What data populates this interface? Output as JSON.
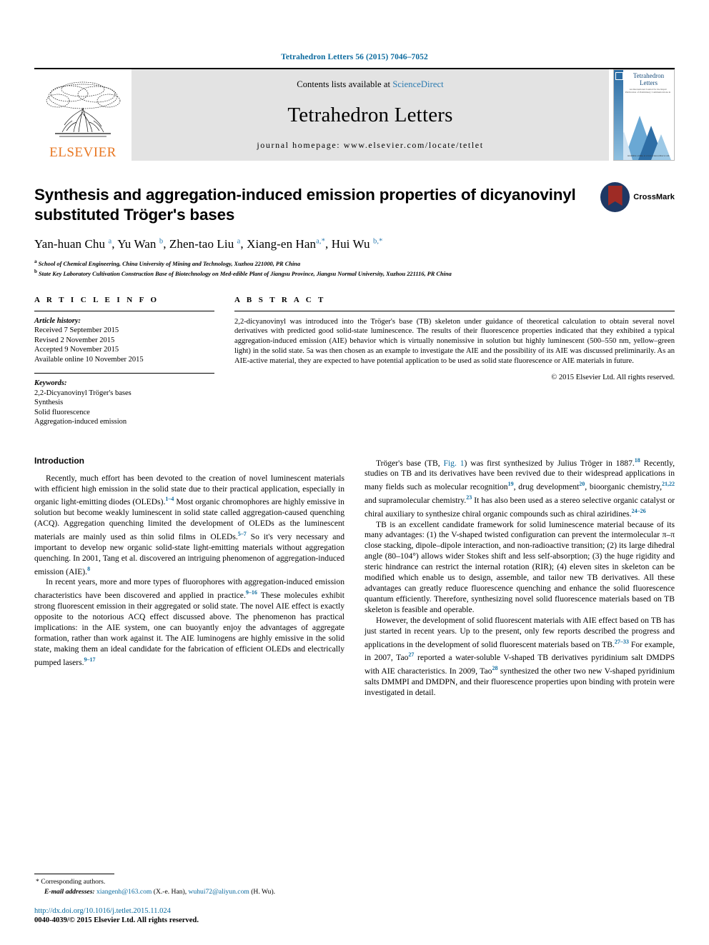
{
  "running_head": "Tetrahedron Letters 56 (2015) 7046–7052",
  "masthead": {
    "contents_prefix": "Contents lists available at",
    "sciencedirect": "ScienceDirect",
    "journal_name": "Tetrahedron Letters",
    "homepage": "journal homepage: www.elsevier.com/locate/tetlet",
    "publisher": "ELSEVIER",
    "cover_title": "Tetrahedron Letters",
    "cover_sub": "An International Journal for the Rapid Publication of Preliminary Communications in Organic Chemistry",
    "cover_bottom": "Available online at www.sciencedirect.com"
  },
  "crossmark": {
    "label": "CrossMark"
  },
  "article": {
    "title": "Synthesis and aggregation-induced emission properties of dicyanovinyl substituted Tröger's bases",
    "authors_html": "Yan-huan Chu <sup>a</sup>, Yu Wan <sup>b</sup>, Zhen-tao Liu <sup>a</sup>, Xiang-en Han<sup>a,*</sup>, Hui Wu <sup>b,*</sup>",
    "affiliation_a": "School of Chemical Engineering, China University of Mining and Technology, Xuzhou 221000, PR China",
    "affiliation_b": "State Key Laboratory Cultivation Construction Base of Biotechnology on Med-edible Plant of Jiangsu Province, Jiangsu Normal University, Xuzhou 221116, PR China"
  },
  "info": {
    "heading": "A R T I C L E   I N F O",
    "history_label": "Article history:",
    "history": [
      "Received 7 September 2015",
      "Revised 2 November 2015",
      "Accepted 9 November 2015",
      "Available online 10 November 2015"
    ],
    "keywords_label": "Keywords:",
    "keywords": [
      "2,2-Dicyanovinyl Tröger's bases",
      "Synthesis",
      "Solid fluorescence",
      "Aggregation-induced emission"
    ]
  },
  "abstract": {
    "heading": "A B S T R A C T",
    "text": "2,2-dicyanovinyl was introduced into the Tröger's base (TB) skeleton under guidance of theoretical calculation to obtain several novel derivatives with predicted good solid-state luminescence. The results of their fluorescence properties indicated that they exhibited a typical aggregation-induced emission (AIE) behavior which is virtually nonemissive in solution but highly luminescent (500–550 nm, yellow–green light) in the solid state. 5a was then chosen as an example to investigate the AIE and the possibility of its AIE was discussed preliminarily. As an AIE-active material, they are expected to have potential application to be used as solid state fluorescence or AIE materials in future.",
    "copyright": "© 2015 Elsevier Ltd. All rights reserved."
  },
  "body": {
    "intro_heading": "Introduction",
    "left_paragraphs_html": [
      "Recently, much effort has been devoted to the creation of novel luminescent materials with efficient high emission in the solid state due to their practical application, especially in organic light-emitting diodes (OLEDs).<sup>1–4</sup> Most organic chromophores are highly emissive in solution but become weakly luminescent in solid state called aggregation-caused quenching (ACQ). Aggregation quenching limited the development of OLEDs as the luminescent materials are mainly used as thin solid films in OLEDs.<sup>5–7</sup> So it's very necessary and important to develop new organic solid-state light-emitting materials without aggregation quenching. In 2001, Tang et al. discovered an intriguing phenomenon of aggregation-induced emission (AIE).<sup>8</sup>",
      "In recent years, more and more types of fluorophores with aggregation-induced emission characteristics have been discovered and applied in practice.<sup>9–16</sup> These molecules exhibit strong fluorescent emission in their aggregated or solid state. The novel AIE effect is exactly opposite to the notorious ACQ effect discussed above. The phenomenon has practical implications: in the AIE system, one can buoyantly enjoy the advantages of aggregate formation, rather than work against it. The AIE luminogens are highly emissive in the solid state, making them an ideal candidate for the fabrication of efficient OLEDs and electrically pumped lasers.<sup>9–17</sup>"
    ],
    "right_paragraphs_html": [
      "Tröger's base (TB, <span class=\"link\">Fig. 1</span>) was first synthesized by Julius Tröger in 1887.<sup>18</sup> Recently, studies on TB and its derivatives have been revived due to their widespread applications in many fields such as molecular recognition<sup>19</sup>, drug development<sup>20</sup>, bioorganic chemistry,<sup>21,22</sup> and supramolecular chemistry.<sup>23</sup> It has also been used as a stereo selective organic catalyst or chiral auxiliary to synthesize chiral organic compounds such as chiral aziridines.<sup>24–26</sup>",
      "TB is an excellent candidate framework for solid luminescence material because of its many advantages: (1) the V-shaped twisted configuration can prevent the intermolecular π–π close stacking, dipole–dipole interaction, and non-radioactive transition; (2) its large dihedral angle (80–104°) allows wider Stokes shift and less self-absorption; (3) the huge rigidity and steric hindrance can restrict the internal rotation (RIR); (4) eleven sites in skeleton can be modified which enable us to design, assemble, and tailor new TB derivatives. All these advantages can greatly reduce fluorescence quenching and enhance the solid fluorescence quantum efficiently. Therefore, synthesizing novel solid fluorescence materials based on TB skeleton is feasible and operable.",
      "However, the development of solid fluorescent materials with AIE effect based on TB has just started in recent years. Up to the present, only few reports described the progress and applications in the development of solid fluorescent materials based on TB.<sup>27–33</sup> For example, in 2007, Tao<sup>27</sup> reported a water-soluble V-shaped TB derivatives pyridinium salt DMDPS with AIE characteristics. In 2009, Tao<sup>28</sup> synthesized the other two new V-shaped pyridinium salts DMMPI and DMDPN, and their fluorescence properties upon binding with protein were investigated in detail."
    ]
  },
  "footer": {
    "corresponding": "* Corresponding authors.",
    "email_label": "E-mail addresses:",
    "email1": "xiangenh@163.com",
    "email1_owner": "(X.-e. Han),",
    "email2": "wuhui72@aliyun.com",
    "email2_owner": "(H. Wu).",
    "doi": "http://dx.doi.org/10.1016/j.tetlet.2015.11.024",
    "issn": "0040-4039/© 2015 Elsevier Ltd. All rights reserved."
  },
  "colors": {
    "link": "#0b6a9e",
    "sciencedirect": "#2a7ab0",
    "elsevier_orange": "#E87722",
    "masthead_bg": "#e3e3e3"
  }
}
